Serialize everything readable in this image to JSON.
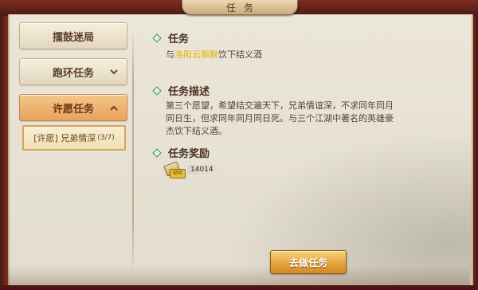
{
  "window": {
    "title": "任务"
  },
  "sidebar": {
    "items": [
      {
        "label": "擂鼓迷局",
        "has_chevron": false,
        "active": false
      },
      {
        "label": "跑环任务",
        "has_chevron": true,
        "chevron": "chevron-down-icon",
        "active": false
      },
      {
        "label": "许愿任务",
        "has_chevron": true,
        "chevron": "chevron-up-icon",
        "active": true
      }
    ],
    "sub_items": [
      {
        "label": "[许愿] 兄弟情深",
        "progress": "(3/7)",
        "selected": true
      }
    ]
  },
  "content": {
    "task_heading": "任务",
    "task_prefix": "与",
    "task_highlight": "洛阳云飘飘",
    "task_suffix": "饮下结义酒",
    "description_heading": "任务描述",
    "description": "第三个愿望，希望结交遍天下，兄弟情谊深，不求同年同月同日生，但求同年同月同日死。与三个江湖中著名的英雄豪杰饮下结义酒。",
    "reward_heading": "任务奖励",
    "reward": {
      "icon": "experience-scroll-icon",
      "badge": "经验",
      "value": "14014"
    }
  },
  "actions": {
    "go_button": "去做任务"
  },
  "colors": {
    "highlight": "#e6b200",
    "active_tab": "#e6a25b",
    "button": "#e6a640"
  }
}
